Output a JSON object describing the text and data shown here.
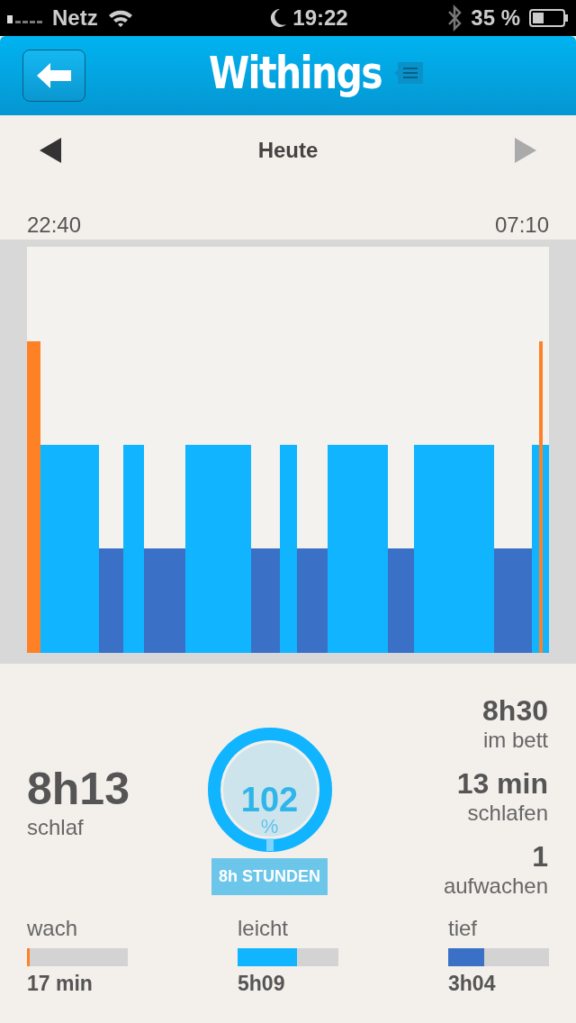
{
  "status_bar": {
    "carrier": "Netz",
    "time": "19:22",
    "battery": "35 %"
  },
  "header": {
    "title": "Withings"
  },
  "date_nav": {
    "label": "Heute",
    "prev_disabled": false,
    "next_disabled": true
  },
  "timeline": {
    "start": "22:40",
    "end": "07:10"
  },
  "summary": {
    "sleep": {
      "value": "8h13",
      "label": "schlaf"
    },
    "goal": {
      "percent": "102",
      "unit": "%",
      "level": 1,
      "target": "8h STUNDEN"
    },
    "stats": [
      {
        "value": "8h30",
        "label": "im bett"
      },
      {
        "value": "13 min",
        "label": "schlafen"
      },
      {
        "value": "1",
        "label": "aufwachen"
      }
    ]
  },
  "phases": [
    {
      "kind": "awake",
      "label": "wach",
      "level": 0.02,
      "value": "17 min"
    },
    {
      "kind": "light",
      "label": "leicht",
      "level": 0.59,
      "value": "5h09"
    },
    {
      "kind": "deep",
      "label": "tief",
      "level": 0.36,
      "value": "3h04"
    }
  ]
}
